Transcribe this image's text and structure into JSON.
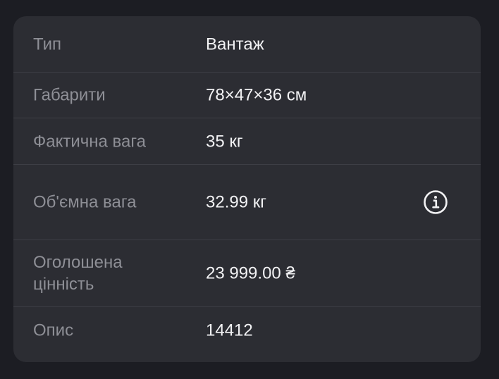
{
  "rows": [
    {
      "label": "Тип",
      "value": "Вантаж"
    },
    {
      "label": "Габарити",
      "value": "78×47×36 см"
    },
    {
      "label": "Фактична вага",
      "value": "35 кг"
    },
    {
      "label": "Об'ємна вага",
      "value": "32.99 кг",
      "icon": "info-icon"
    },
    {
      "label": "Оголошена цінність",
      "value": "23 999.00 ₴"
    },
    {
      "label": "Опис",
      "value": "14412"
    }
  ],
  "colors": {
    "background": "#1c1d23",
    "card": "#2c2d33",
    "divider": "#3d3e45",
    "label": "#8e8f96",
    "value": "#f2f2f4"
  }
}
